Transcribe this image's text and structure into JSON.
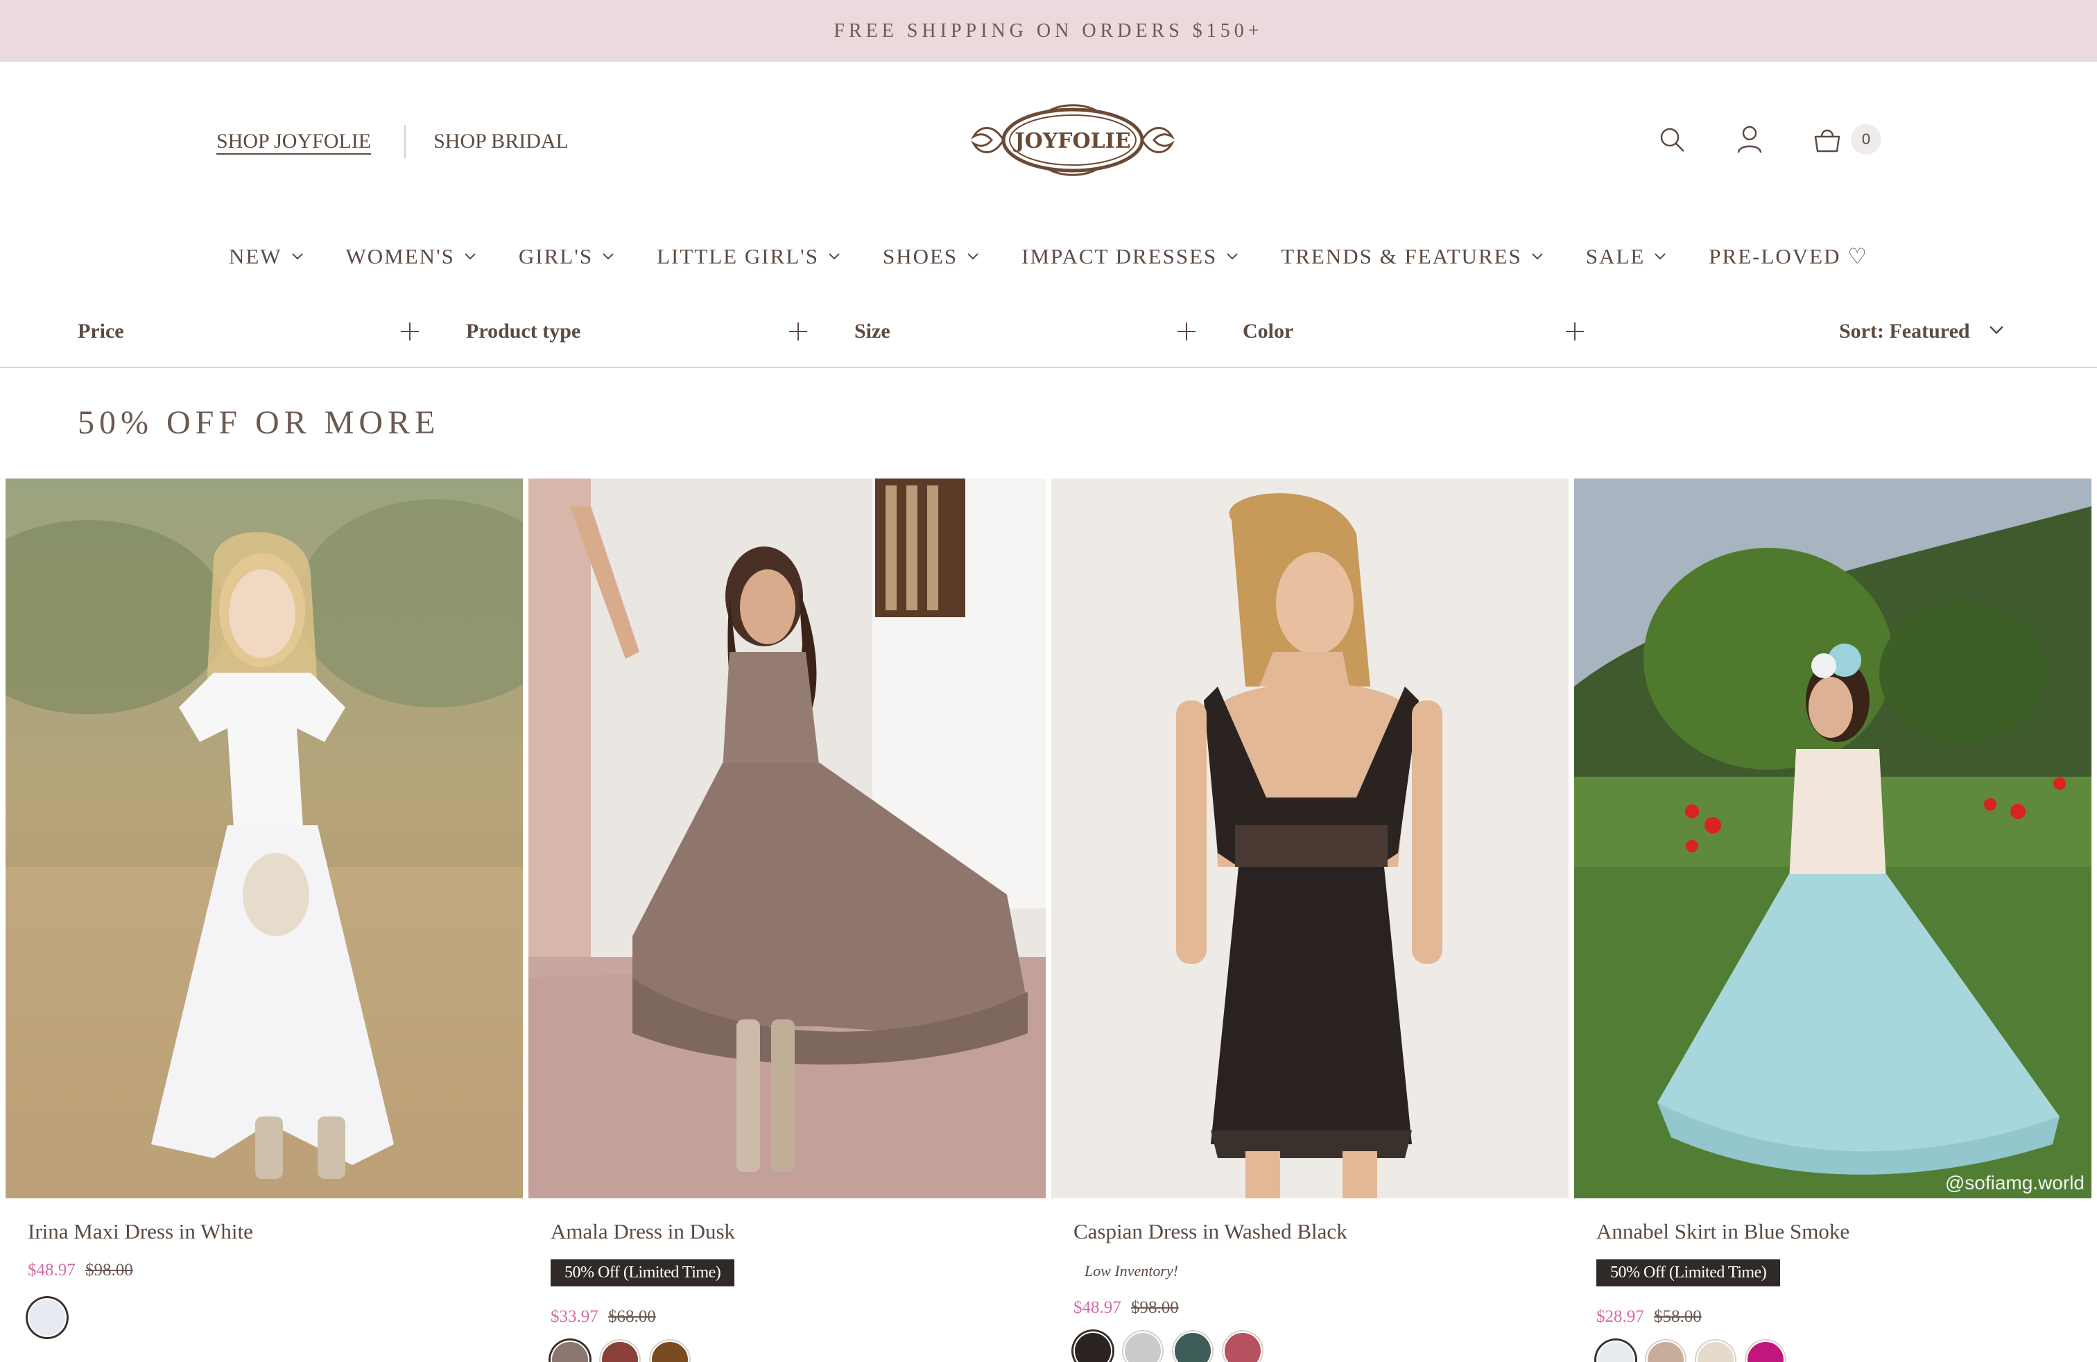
{
  "announcement": "FREE SHIPPING ON ORDERS $150+",
  "header": {
    "shop_links": [
      {
        "label": "SHOP JOYFOLIE",
        "active": true
      },
      {
        "label": "SHOP BRIDAL",
        "active": false
      }
    ],
    "logo_text": "JOYFOLIE",
    "icons": [
      "search-icon",
      "account-icon",
      "cart-icon"
    ],
    "cart_count": "0"
  },
  "nav": [
    {
      "label": "NEW"
    },
    {
      "label": "WOMEN'S"
    },
    {
      "label": "GIRL'S"
    },
    {
      "label": "LITTLE GIRL'S"
    },
    {
      "label": "SHOES"
    },
    {
      "label": "IMPACT DRESSES"
    },
    {
      "label": "TRENDS & FEATURES"
    },
    {
      "label": "SALE"
    },
    {
      "label": "PRE-LOVED ♡"
    }
  ],
  "filters": {
    "price": "Price",
    "product_type": "Product type",
    "size": "Size",
    "color": "Color",
    "sort": "Sort: Featured"
  },
  "collection_title": "50% OFF OR MORE",
  "products": [
    {
      "name": "Irina Maxi Dress in White",
      "badge": "",
      "note": "",
      "sale_price": "$48.97",
      "original_price": "$98.00",
      "swatches": [
        "#e6ebf3"
      ]
    },
    {
      "name": "Amala Dress in Dusk",
      "badge": "50% Off (Limited Time)",
      "note": "",
      "sale_price": "$33.97",
      "original_price": "$68.00",
      "swatches": [
        "#8b7770",
        "#8a3f3a",
        "#7a4a20"
      ]
    },
    {
      "name": "Caspian Dress in Washed Black",
      "badge": "",
      "note": "Low Inventory!",
      "sale_price": "$48.97",
      "original_price": "$98.00",
      "swatches": [
        "#2a2322",
        "#c9ccc8",
        "#3e5c58",
        "#b65260"
      ]
    },
    {
      "name": "Annabel Skirt in Blue Smoke",
      "badge": "50% Off (Limited Time)",
      "note": "",
      "sale_price": "$28.97",
      "original_price": "$58.00",
      "swatches": [
        "#e9ecef",
        "#c9ad9c",
        "#e6dacb",
        "#c1177d"
      ],
      "watermark": "@sofiamg.world"
    }
  ],
  "colors": {
    "announcement_bg": "#ead9dd",
    "text": "#5b4a40",
    "sale_price": "#d46ca5",
    "badge_bg": "#2f2a28"
  }
}
